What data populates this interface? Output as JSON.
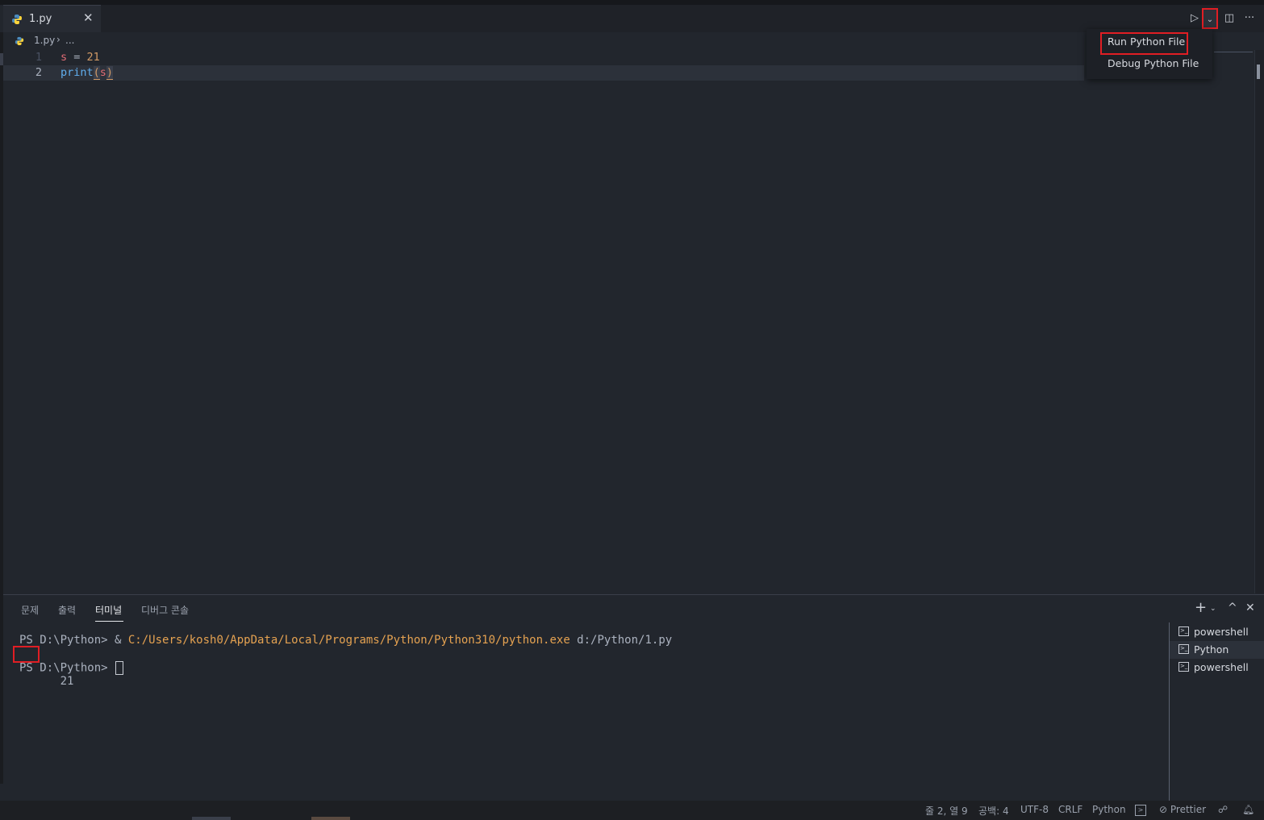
{
  "tab": {
    "title": "1.py",
    "close": "✕"
  },
  "toolbar": {
    "run_icon": "▷",
    "dropdown_icon": "⌄",
    "split_icon": "◫",
    "more_icon": "···"
  },
  "breadcrumb": {
    "file": "1.py",
    "separator": "›",
    "more": "..."
  },
  "editor": {
    "lines": [
      {
        "number": "1",
        "tokens": [
          "s",
          " = ",
          "21"
        ]
      },
      {
        "number": "2",
        "tokens": [
          "print",
          "(",
          "s",
          ")"
        ]
      }
    ]
  },
  "run_menu": {
    "items": [
      "Run Python File",
      "Debug Python File"
    ]
  },
  "panel": {
    "tabs": [
      "문제",
      "출력",
      "터미널",
      "디버그 콘솔"
    ],
    "active_tab": "터미널",
    "icons": {
      "new": "+",
      "new_dropdown": "⌄",
      "maximize": "^",
      "close": "✕"
    }
  },
  "terminal": {
    "prompt": "PS D:\\Python> ",
    "amp": "& ",
    "exe_path": "C:/Users/kosh0/AppData/Local/Programs/Python/Python310/python.exe",
    "arg": " d:/Python/1.py",
    "output": "21",
    "prompt2": "PS D:\\Python> "
  },
  "terminal_list": [
    "powershell",
    "Python",
    "powershell"
  ],
  "status_bar": {
    "line_col": "줄 2, 열 9",
    "spaces": "공백: 4",
    "encoding": "UTF-8",
    "eol": "CRLF",
    "language": "Python",
    "prettier": "⊘ Prettier",
    "feedback_icon": "☍",
    "bell_icon": "🔔︎"
  },
  "colors": {
    "accent_highlight": "#e01e24",
    "background": "#22262d"
  }
}
